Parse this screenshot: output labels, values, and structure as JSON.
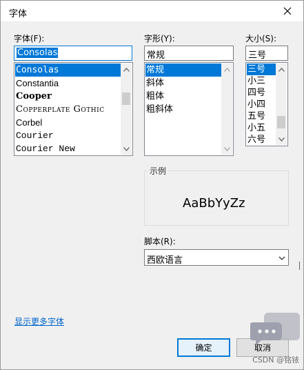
{
  "window": {
    "title": "字体",
    "close_icon": "close-icon"
  },
  "font": {
    "label": "字体(F):",
    "input_value": "Consolas",
    "items": [
      "Consolas",
      "Constantia",
      "Cooper",
      "Copperplate Gothic",
      "Corbel",
      "Courier",
      "Courier New"
    ],
    "selected_index": 0,
    "scroll_fraction": 0.3
  },
  "style": {
    "label": "字形(Y):",
    "input_value": "常规",
    "items": [
      "常规",
      "斜体",
      "粗体",
      "粗斜体"
    ],
    "selected_index": 0
  },
  "size": {
    "label": "大小(S):",
    "input_value": "三号",
    "items": [
      "三号",
      "小三",
      "四号",
      "小四",
      "五号",
      "小五",
      "六号"
    ],
    "selected_index": 0,
    "scroll_fraction": 0.55
  },
  "sample": {
    "group_label": "示例",
    "text": "AaBbYyZz"
  },
  "script": {
    "label": "脚本(R):",
    "value": "西欧语言"
  },
  "more_fonts_link": "显示更多字体",
  "buttons": {
    "ok": "确定",
    "cancel": "取消"
  },
  "watermark": "CSDN @铭铱",
  "colors": {
    "selection": "#0078d7",
    "link": "#0066cc",
    "default_button_border": "#0078d7"
  }
}
